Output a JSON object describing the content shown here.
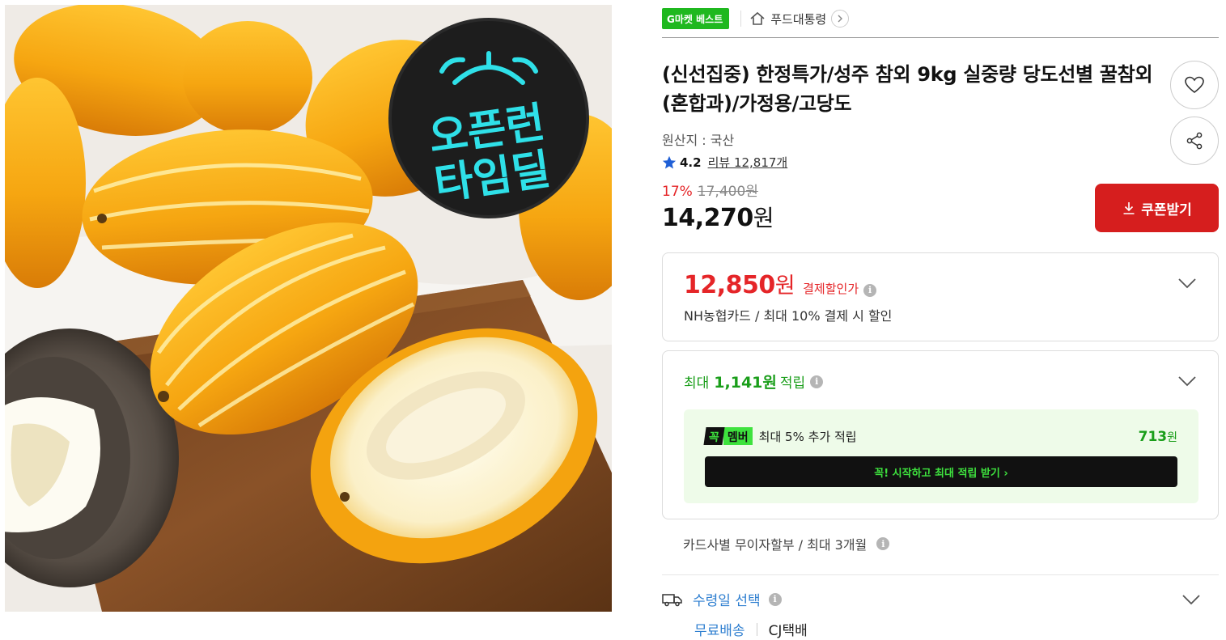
{
  "image": {
    "badge_line1": "오픈런",
    "badge_line2": "타임딜"
  },
  "breadcrumb": {
    "best_badge": "G마켓 베스트",
    "category": "푸드대통령"
  },
  "product": {
    "title": "(신선집중) 한정특가/성주 참외 9kg 실중량 당도선별 꿀참외(혼합과)/가정용/고당도",
    "origin": "원산지 : 국산",
    "rating": "4.2",
    "review_label": "리뷰 12,817개",
    "discount_pct": "17%",
    "original_price": "17,400원",
    "price_number": "14,270",
    "price_unit": "원"
  },
  "actions": {
    "coupon_label": "쿠폰받기"
  },
  "payment": {
    "price_number": "12,850",
    "price_unit": "원",
    "label": "결제할인가",
    "desc": "NH농협카드 / 최대 10% 결제 시 할인"
  },
  "points": {
    "prefix": "최대",
    "amount": "1,141원",
    "suffix": "적립",
    "member_logo_k": "꼭",
    "member_logo_m": "멤버",
    "member_text": "최대 5% 추가 적립",
    "member_amount_number": "713",
    "member_amount_unit": "원",
    "cta": "꼭! 시작하고 최대 적립 받기  ›"
  },
  "installment": "카드사별 무이자할부 / 최대 3개월",
  "delivery": {
    "label": "수령일 선택",
    "free": "무료배송",
    "carrier": "CJ택배"
  },
  "colors": {
    "red": "#d61e1e",
    "green": "#1a9e1a",
    "blue": "#2f7fd0",
    "neon": "#3ee23e"
  }
}
